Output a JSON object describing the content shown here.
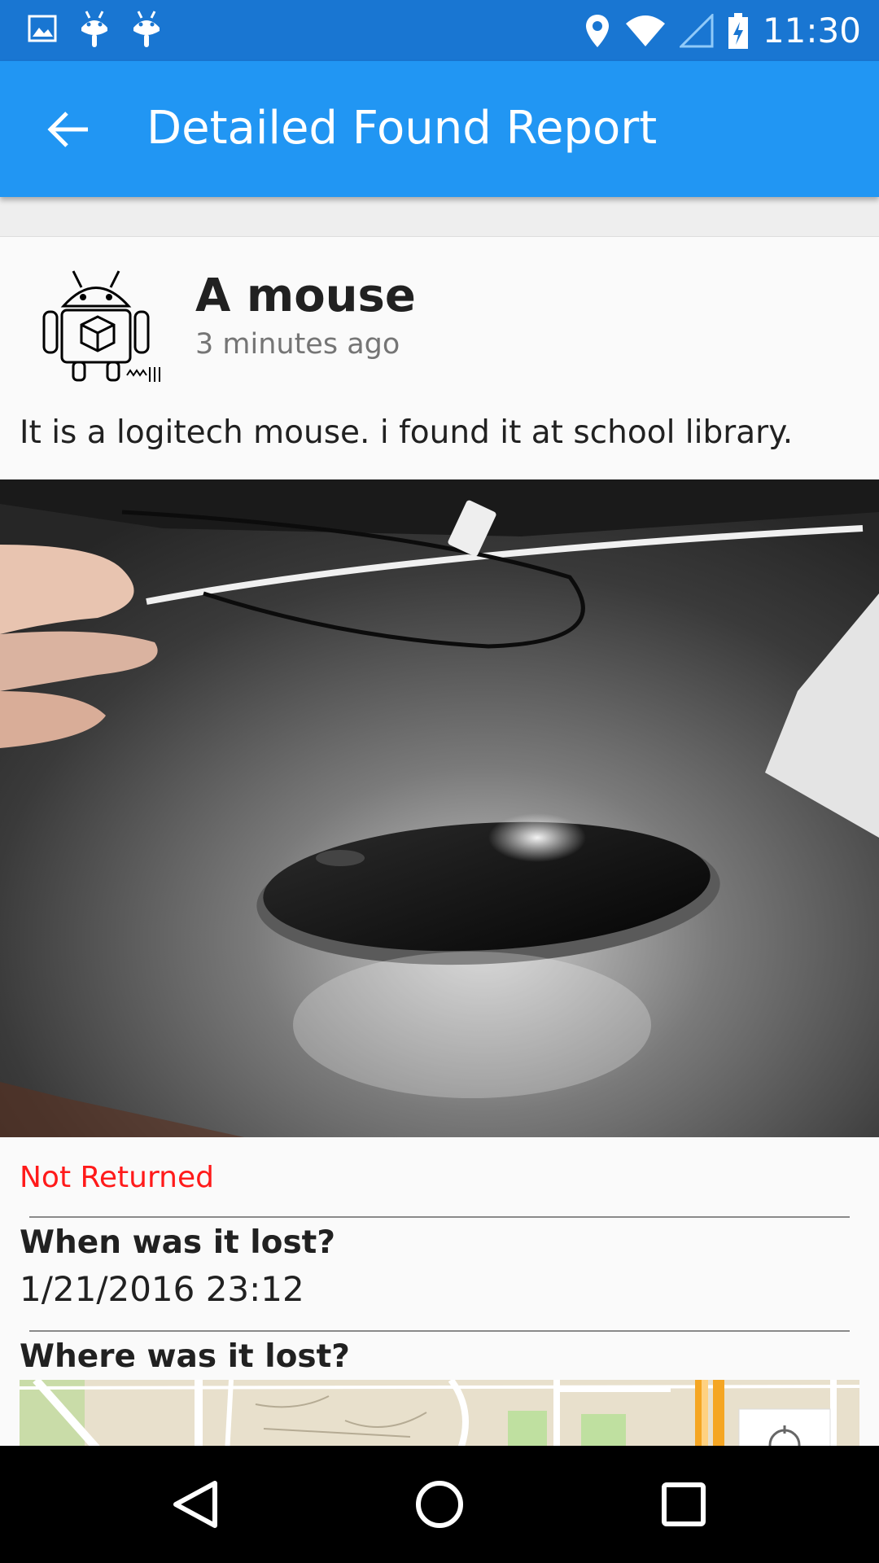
{
  "status_bar": {
    "time": "11:30",
    "left_icons": [
      "image-notification-icon",
      "android-notification-icon",
      "android-notification-icon"
    ],
    "right_icons": [
      "location-icon",
      "wifi-icon",
      "cell-signal-icon",
      "battery-charging-icon"
    ]
  },
  "app_bar": {
    "back_icon": "arrow-left-icon",
    "title": "Detailed Found Report"
  },
  "report": {
    "title": "A mouse",
    "time_ago": "3 minutes ago",
    "description": "It is a logitech mouse. i found it at school library.",
    "avatar_icon": "android-robot-sketch",
    "status": "Not Returned",
    "status_color": "#ff1a1a",
    "when_label": "When was it lost?",
    "when_value": "1/21/2016 23:12",
    "where_label": "Where was it lost?"
  },
  "nav_bar": {
    "buttons": [
      "back-triangle-icon",
      "home-circle-icon",
      "recents-square-icon"
    ]
  },
  "colors": {
    "status_bar": "#1976d2",
    "app_bar": "#2196f3",
    "card_background": "#fafafa"
  }
}
